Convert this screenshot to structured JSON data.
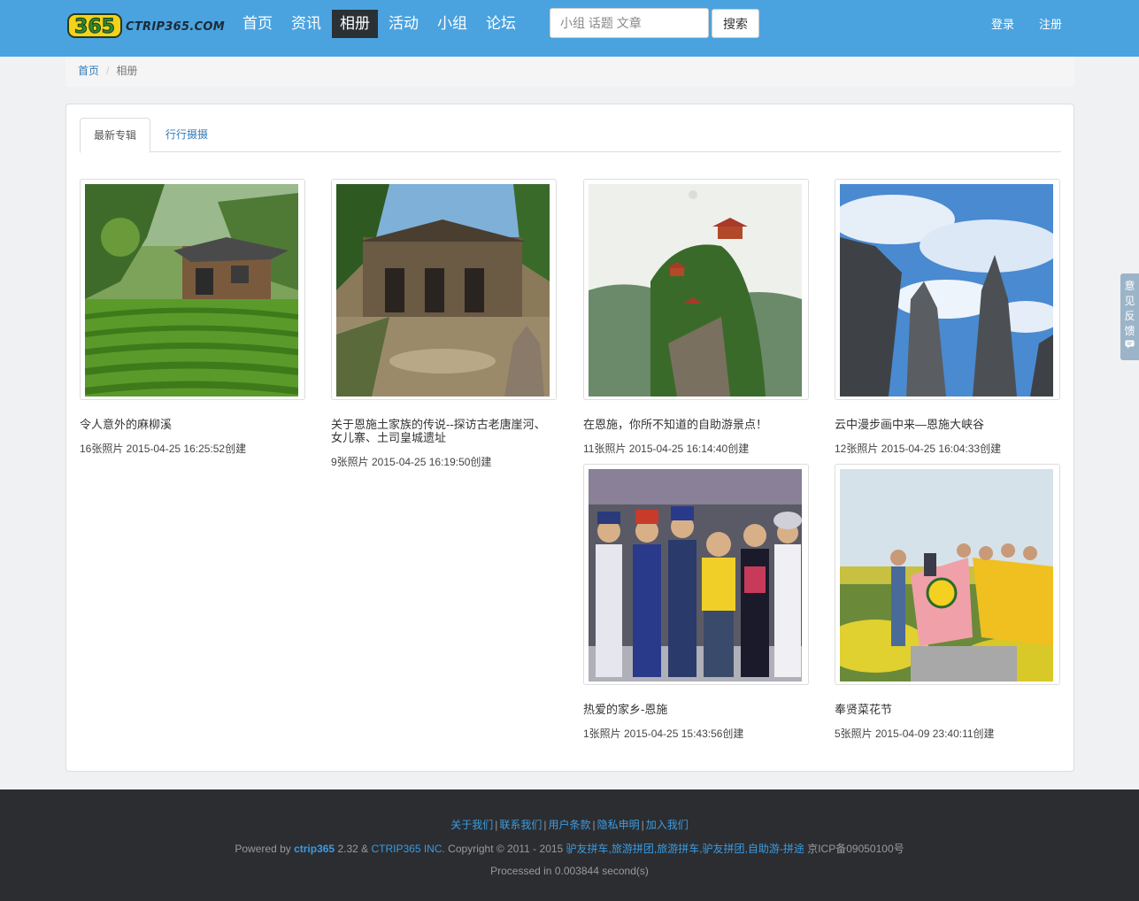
{
  "header": {
    "logo_text": "CTRIP365.COM",
    "nav": [
      "首页",
      "资讯",
      "相册",
      "活动",
      "小组",
      "论坛"
    ],
    "active_nav": "相册",
    "search_placeholder": "小组 话题 文章",
    "search_button": "搜索",
    "login": "登录",
    "register": "注册"
  },
  "breadcrumb": {
    "home": "首页",
    "current": "相册"
  },
  "tabs": {
    "latest": "最新专辑",
    "photography": "行行摄摄"
  },
  "albums": [
    {
      "title": "令人意外的麻柳溪",
      "meta": "16张照片  2015-04-25 16:25:52创建"
    },
    {
      "title": "关于恩施土家族的传说--探访古老唐崖河、女儿寨、土司皇城遗址",
      "meta": "9张照片  2015-04-25 16:19:50创建"
    },
    {
      "title": "在恩施，你所不知道的自助游景点！",
      "meta": "11张照片  2015-04-25 16:14:40创建"
    },
    {
      "title": "云中漫步画中来—恩施大峡谷",
      "meta": "12张照片  2015-04-25 16:04:33创建"
    },
    {
      "title": "热爱的家乡-恩施",
      "meta": "1张照片  2015-04-25 15:43:56创建"
    },
    {
      "title": "奉贤菜花节",
      "meta": "5张照片  2015-04-09 23:40:11创建"
    }
  ],
  "feedback": [
    "意",
    "见",
    "反",
    "馈"
  ],
  "footer": {
    "links": [
      "关于我们",
      "联系我们",
      "用户条款",
      "隐私申明",
      "加入我们"
    ],
    "powered_prefix": "Powered by ",
    "powered_brand": "ctrip365",
    "powered_version": " 2.32 & ",
    "company": "CTRIP365 INC.",
    "copyright": " Copyright © 2011 - 2015 ",
    "keywords": "驴友拼车,旅游拼团,旅游拼车,驴友拼团,自助游-拼途",
    "icp": " 京ICP备09050100号",
    "processed": "Processed in 0.003844 second(s)"
  },
  "colors": {
    "header": "#4aa3df",
    "nav_active": "#2b3035",
    "link": "#337ab7",
    "footer": "#2b2d31"
  }
}
